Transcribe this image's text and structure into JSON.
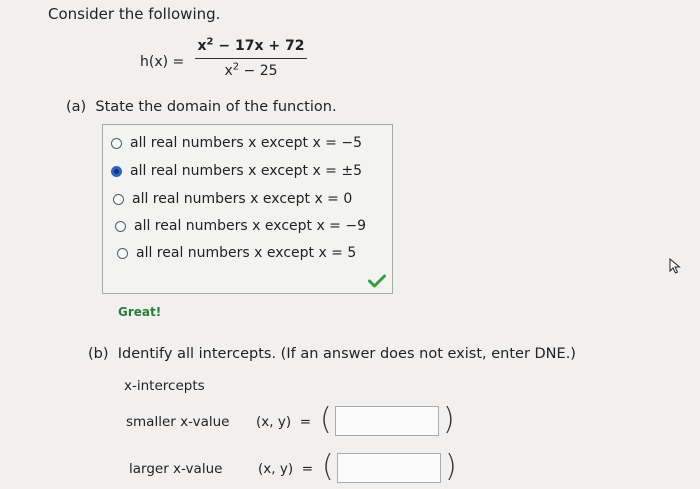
{
  "intro": "Consider the following.",
  "function": {
    "name": "h(x)",
    "equals": "=",
    "num_a": "x",
    "num_a_exp": "2",
    "num_b": " − 17x + 72",
    "den_a": "x",
    "den_a_exp": "2",
    "den_b": " − 25"
  },
  "part_a": {
    "label": "(a)",
    "question": "State the domain of the function.",
    "options": [
      {
        "text": "all real numbers x except x = −5",
        "selected": false
      },
      {
        "text": "all real numbers x except x = ±5",
        "selected": true
      },
      {
        "text": "all real numbers x except x = 0",
        "selected": false
      },
      {
        "text": "all real numbers x except x = −9",
        "selected": false
      },
      {
        "text": "all real numbers x except x = 5",
        "selected": false
      }
    ],
    "feedback": "Great!",
    "check_color": "#3a9a3e"
  },
  "part_b": {
    "label": "(b)",
    "question": "Identify all intercepts. (If an answer does not exist, enter DNE.)",
    "subheading": "x-intercepts",
    "rows": [
      {
        "label": "smaller x-value",
        "coord": "(x, y)",
        "equals": "=",
        "open_paren": "(",
        "close_paren": ")",
        "value": "",
        "placeholder": ""
      },
      {
        "label": "larger x-value",
        "coord": "(x, y)",
        "equals": "=",
        "open_paren": "(",
        "close_paren": ")",
        "value": "",
        "placeholder": ""
      }
    ]
  },
  "icons": {
    "selected_radio": "radio-selected-icon",
    "check": "checkmark-icon",
    "cursor": "mouse-pointer-icon"
  }
}
